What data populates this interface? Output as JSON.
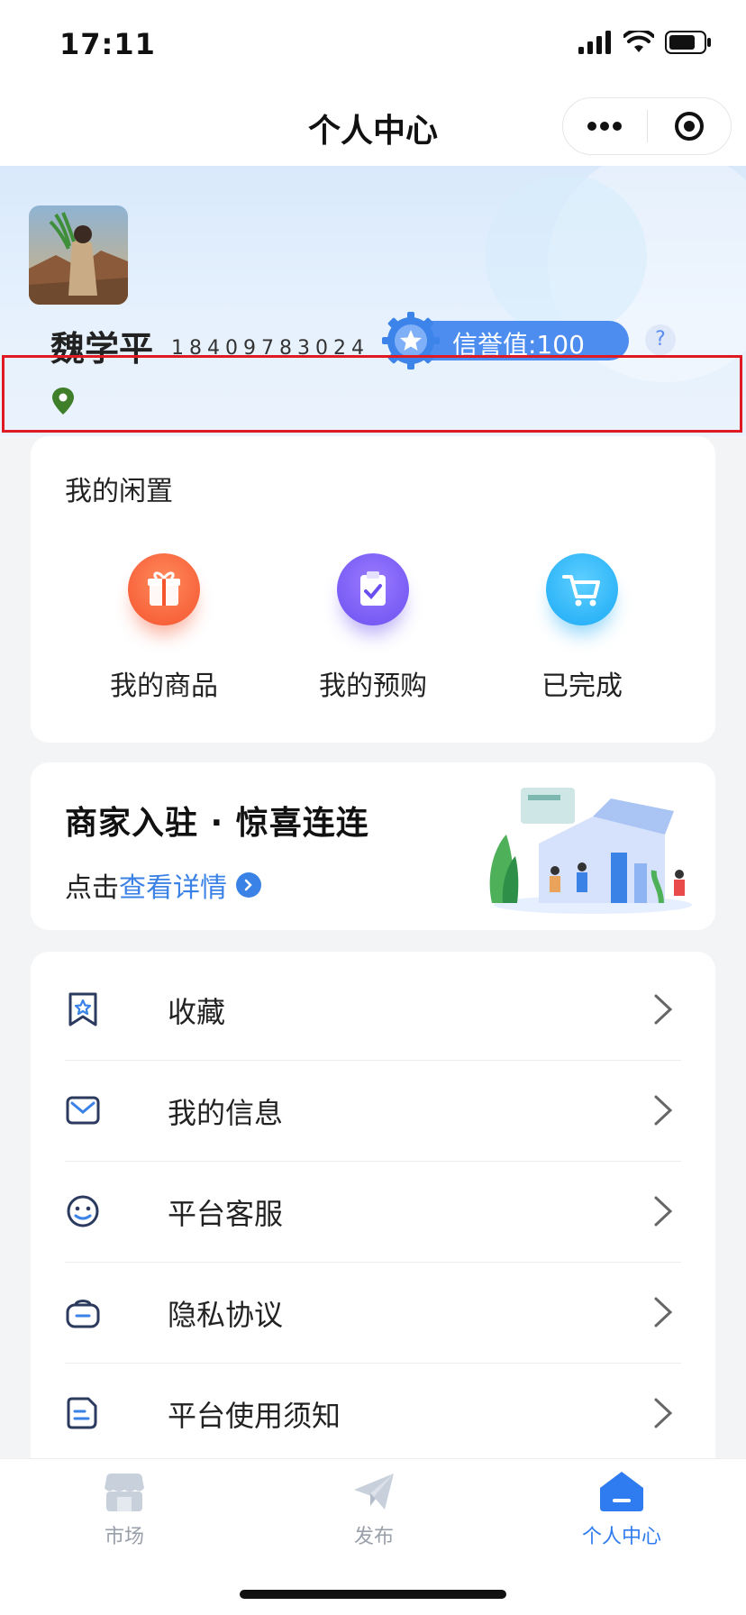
{
  "status_bar": {
    "time": "17:11"
  },
  "nav": {
    "title": "个人中心"
  },
  "profile": {
    "name": "魏学平",
    "phone": "18409783024",
    "credit": "信誉值:100",
    "help": "?"
  },
  "idle": {
    "title": "我的闲置",
    "items": [
      {
        "label": "我的商品",
        "icon": "gift-icon",
        "color": "#f5542f"
      },
      {
        "label": "我的预购",
        "icon": "clipboard-check-icon",
        "color": "#6b4ff0"
      },
      {
        "label": "已完成",
        "icon": "cart-icon",
        "color": "#1aa9f5"
      }
    ]
  },
  "merchant": {
    "title": "商家入驻 · 惊喜连连",
    "prefix": "点击",
    "link": "查看详情"
  },
  "menu": [
    {
      "label": "收藏",
      "icon": "bookmark-star-icon"
    },
    {
      "label": "我的信息",
      "icon": "mail-icon"
    },
    {
      "label": "平台客服",
      "icon": "smile-face-icon"
    },
    {
      "label": "隐私协议",
      "icon": "bag-icon"
    },
    {
      "label": "平台使用须知",
      "icon": "document-icon"
    }
  ],
  "tabs": [
    {
      "label": "市场",
      "icon": "shop-icon",
      "active": false
    },
    {
      "label": "发布",
      "icon": "paper-plane-icon",
      "active": false
    },
    {
      "label": "个人中心",
      "icon": "home-icon",
      "active": true
    }
  ],
  "colors": {
    "accent": "#3b82e6",
    "highlight": "#e01a22"
  }
}
